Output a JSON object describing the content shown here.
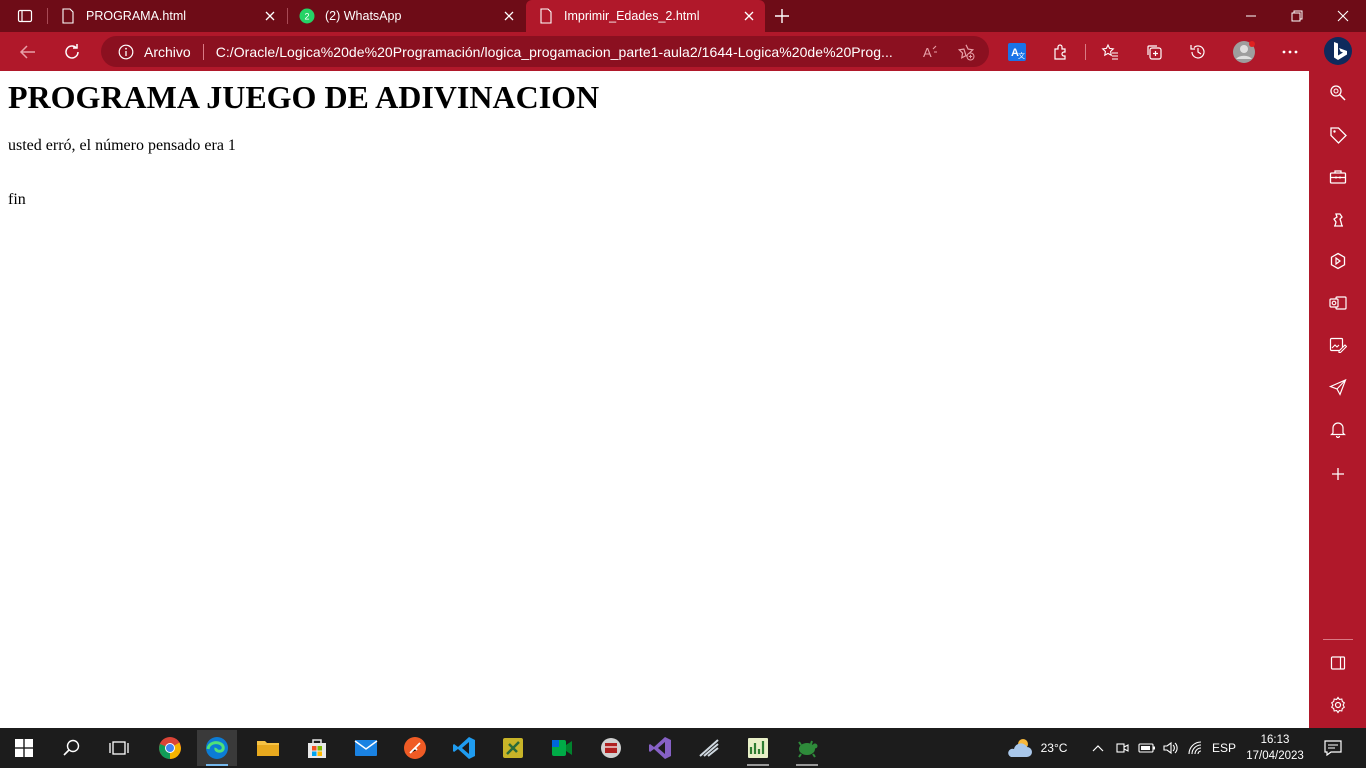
{
  "browser": {
    "tabs": [
      {
        "label": "PROGRAMA.html",
        "icon": "file-icon",
        "active": false
      },
      {
        "label": "(2) WhatsApp",
        "icon": "whatsapp-icon",
        "badge": "2",
        "active": false
      },
      {
        "label": "Imprimir_Edades_2.html",
        "icon": "file-icon",
        "active": true
      }
    ],
    "address": {
      "site_label": "Archivo",
      "url": "C:/Oracle/Logica%20de%20Programación/logica_progamacion_parte1-aula2/1644-Logica%20de%20Prog..."
    },
    "colors": {
      "accent": "#b0182a",
      "tabstrip": "#6e0c17"
    }
  },
  "page": {
    "heading": "PROGRAMA JUEGO DE ADIVINACION",
    "message": "usted erró, el número pensado era 1",
    "end_text": "fin"
  },
  "taskbar": {
    "weather": {
      "temp": "23°C",
      "icon": "cloud-sun-icon"
    },
    "language": "ESP",
    "time": "16:13",
    "date": "17/04/2023"
  }
}
